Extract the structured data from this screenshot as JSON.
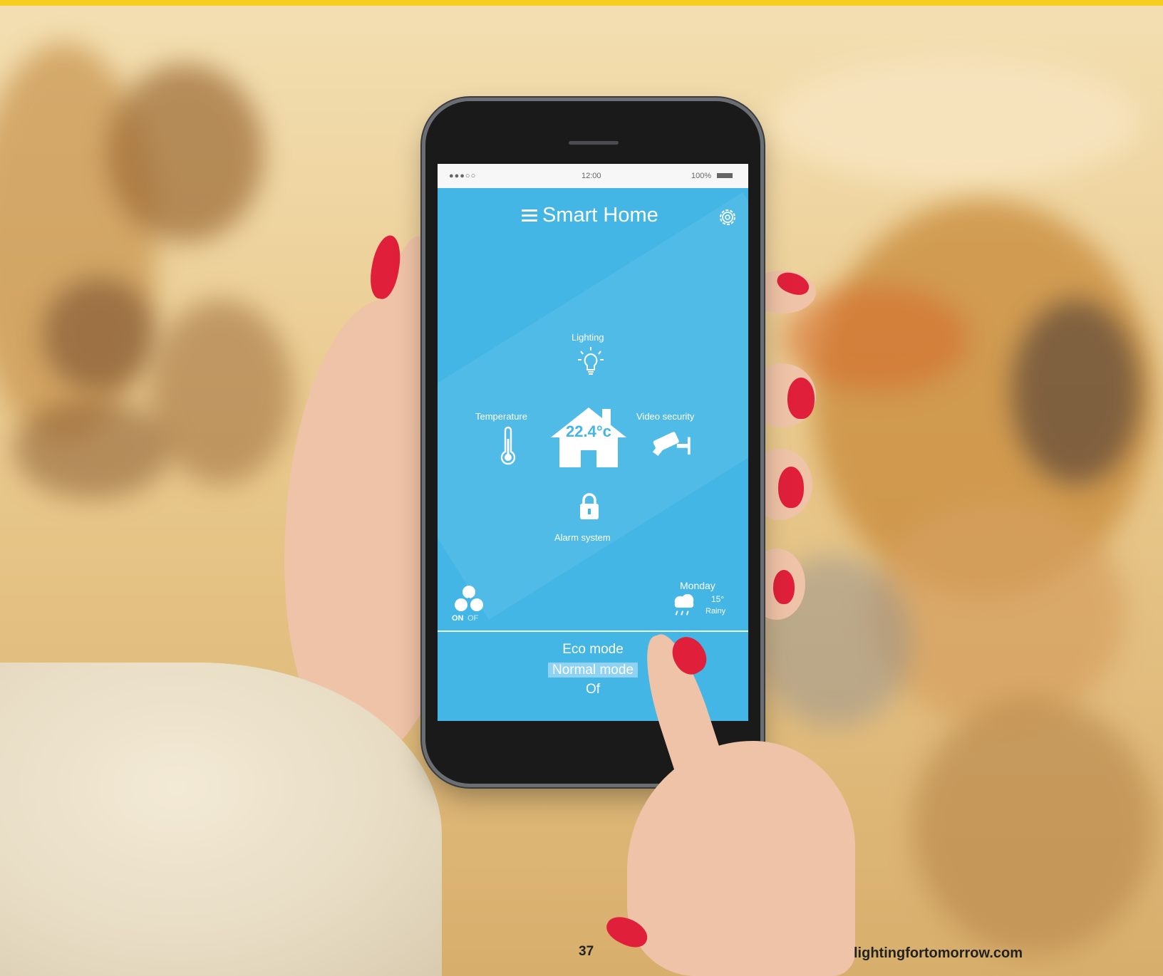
{
  "status_bar": {
    "signal": "●●●○○",
    "time": "12:00",
    "battery": "100%"
  },
  "app": {
    "title": "Smart Home"
  },
  "controls": {
    "lighting": "Lighting",
    "temperature": "Temperature",
    "house_temp": "22.4°c",
    "video_security": "Video security",
    "alarm": "Alarm system"
  },
  "fan": {
    "on": "ON",
    "off": "OF"
  },
  "weather": {
    "day": "Monday",
    "temp": "15°",
    "condition": "Rainy"
  },
  "modes": [
    "Eco mode",
    "Normal mode",
    "Of"
  ],
  "selected_mode": "Normal mode",
  "footer": {
    "page_number": "37",
    "website": "lightingfortomorrow.com"
  },
  "colors": {
    "screen": "#44b6e6",
    "accent_bar": "#f5cf1b",
    "nail": "#e0203b"
  }
}
